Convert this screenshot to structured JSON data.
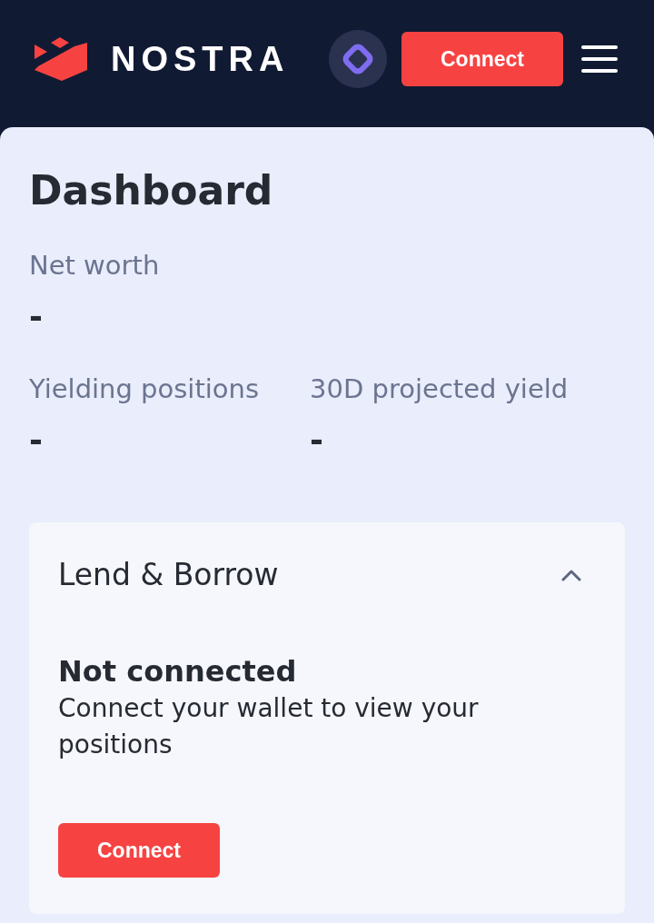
{
  "header": {
    "brand": "NOSTRA",
    "connect_button": "Connect"
  },
  "dashboard": {
    "title": "Dashboard",
    "stats": [
      {
        "label": "Net worth",
        "value": "-"
      },
      {
        "label": "Yielding positions",
        "value": "-"
      },
      {
        "label": "30D projected yield",
        "value": "-"
      }
    ]
  },
  "section": {
    "title": "Lend & Borrow",
    "expanded": true,
    "status_title": "Not connected",
    "status_text": "Connect your wallet to view your positions",
    "connect_button": "Connect"
  }
}
